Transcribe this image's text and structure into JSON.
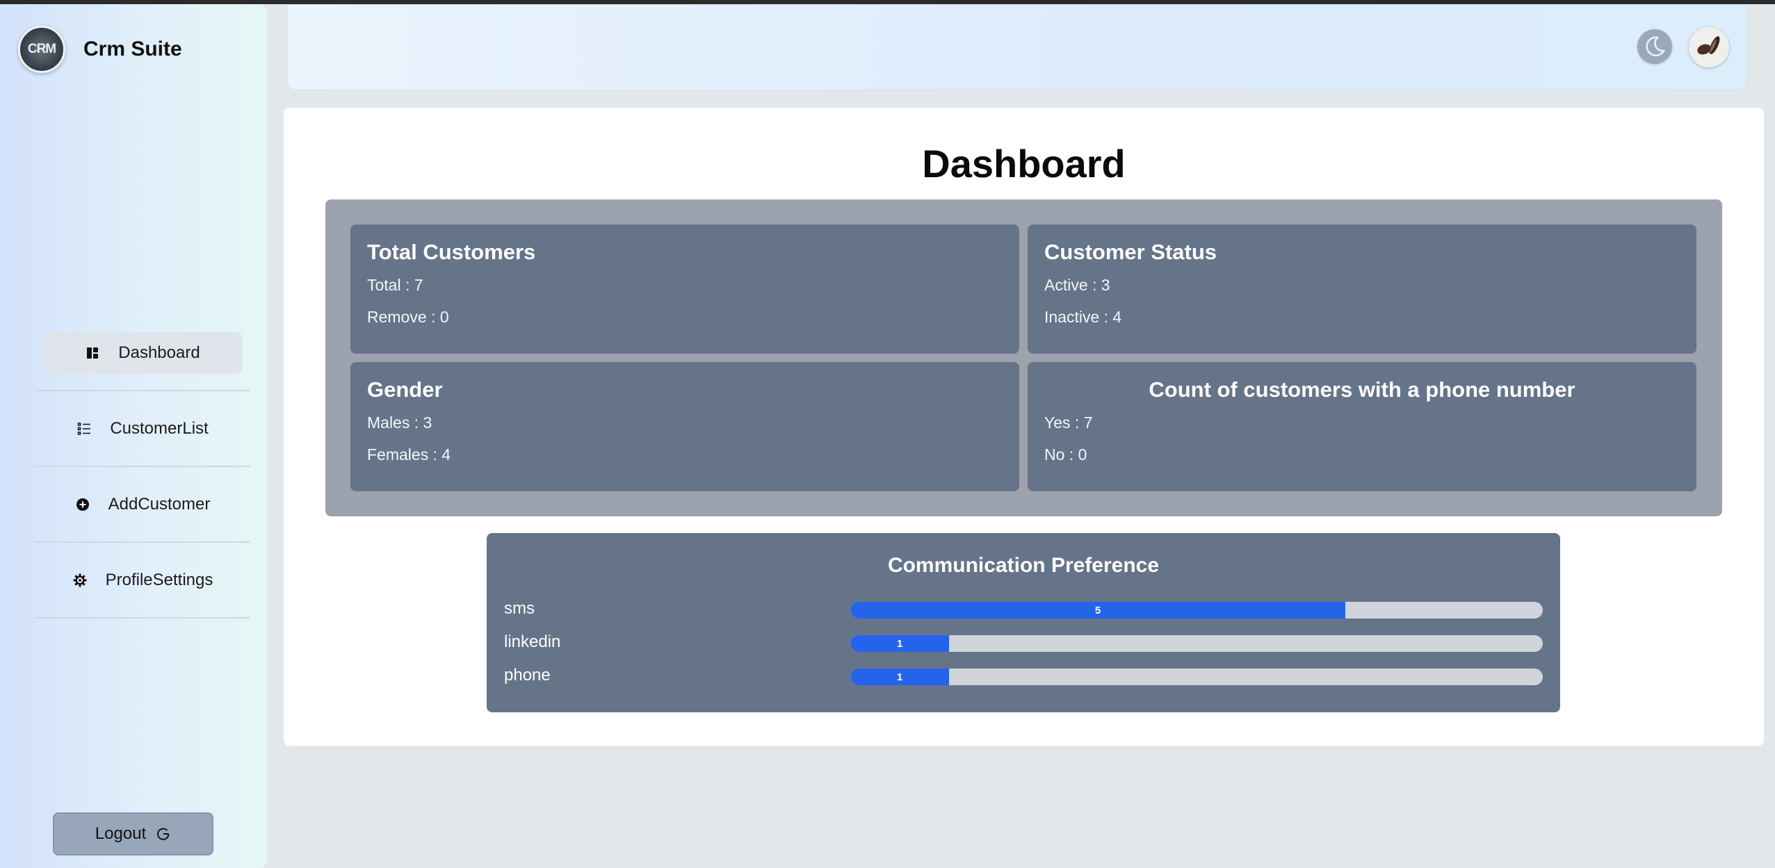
{
  "app": {
    "name": "Crm Suite",
    "logo_text": "CRM"
  },
  "sidebar": {
    "items": [
      {
        "label": "Dashboard",
        "icon": "dashboard-icon",
        "active": true
      },
      {
        "label": "CustomerList",
        "icon": "list-icon",
        "active": false
      },
      {
        "label": "AddCustomer",
        "icon": "plus-circle-icon",
        "active": false
      },
      {
        "label": "ProfileSettings",
        "icon": "gear-icon",
        "active": false
      }
    ],
    "logout_label": "Logout"
  },
  "header": {
    "theme_toggle_icon": "moon-icon",
    "avatar_icon": "user-avatar"
  },
  "main": {
    "title": "Dashboard",
    "cards": {
      "total_customers": {
        "title": "Total Customers",
        "line1": "Total : 7",
        "line2": "Remove : 0"
      },
      "customer_status": {
        "title": "Customer Status",
        "line1": "Active : 3",
        "line2": "Inactive : 4"
      },
      "gender": {
        "title": "Gender",
        "line1": "Males : 3",
        "line2": "Females : 4"
      },
      "phone": {
        "title": "Count of customers with a phone number",
        "line1": "Yes : 7",
        "line2": "No : 0"
      }
    },
    "communication": {
      "title": "Communication Preference",
      "rows": [
        {
          "label": "sms",
          "value": "5",
          "fraction": 0.715
        },
        {
          "label": "linkedin",
          "value": "1",
          "fraction": 0.143
        },
        {
          "label": "phone",
          "value": "1",
          "fraction": 0.143
        }
      ]
    }
  },
  "colors": {
    "accent": "#2563eb",
    "card": "#657489",
    "panel": "#9ca3ae",
    "track": "#d1d5db"
  }
}
